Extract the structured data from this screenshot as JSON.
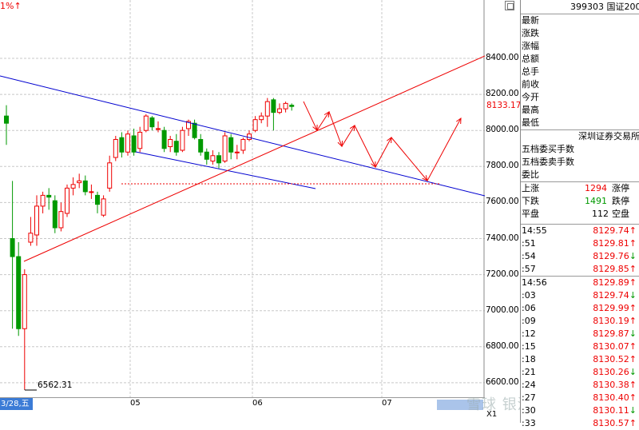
{
  "chart": {
    "corner_label": "1%↑",
    "low_label": "6562.31",
    "last_price": "8133.17",
    "axis_labels": [
      "8400.00",
      "8200.00",
      "8000.00",
      "7800.00",
      "7600.00",
      "7400.00",
      "7200.00",
      "7000.00",
      "6800.00",
      "6600.00"
    ],
    "date_box": "3/28,五",
    "date_ticks": [
      "05",
      "06",
      "07"
    ],
    "zoom_label": "X1"
  },
  "quote": {
    "code_name": "399303 国证2000",
    "fields": [
      "最新",
      "涨跌",
      "涨幅",
      "总额",
      "总手",
      "前收",
      "今开",
      "最高",
      "最低"
    ],
    "exchange": "深圳证券交易所",
    "fields2": [
      "五档委买手数",
      "五档委卖手数",
      "委比"
    ],
    "up_label": "上涨",
    "up_count": "1294",
    "limit_up_label": "涨停",
    "down_label": "下跌",
    "down_count": "1491",
    "limit_down_label": "跌停",
    "flat_label": "平盘",
    "flat_count": "112",
    "suspend_label": "空盘"
  },
  "ticks": [
    {
      "time": "14:55",
      "price": "8129.74",
      "dir": "↑"
    },
    {
      "time": ":51",
      "price": "8129.81",
      "dir": "↑"
    },
    {
      "time": ":54",
      "price": "8129.76",
      "dir": "↓"
    },
    {
      "time": ":57",
      "price": "8129.85",
      "dir": "↑"
    },
    {
      "time": "14:56",
      "price": "8129.89",
      "dir": "↑"
    },
    {
      "time": ":03",
      "price": "8129.74",
      "dir": "↓"
    },
    {
      "time": ":06",
      "price": "8129.99",
      "dir": "↑"
    },
    {
      "time": ":09",
      "price": "8130.19",
      "dir": "↑"
    },
    {
      "time": ":12",
      "price": "8129.87",
      "dir": "↓"
    },
    {
      "time": ":15",
      "price": "8130.07",
      "dir": "↑"
    },
    {
      "time": ":18",
      "price": "8130.52",
      "dir": "↑"
    },
    {
      "time": ":21",
      "price": "8130.26",
      "dir": "↓"
    },
    {
      "time": ":24",
      "price": "8130.38",
      "dir": "↑"
    },
    {
      "time": ":27",
      "price": "8130.40",
      "dir": "↑"
    },
    {
      "time": ":30",
      "price": "8130.11",
      "dir": "↓"
    },
    {
      "time": ":33",
      "price": "8130.57",
      "dir": "↑"
    }
  ],
  "watermark": "雪球 银河宝凡",
  "candles": [
    {
      "o": 8080,
      "c": 8040,
      "h": 8140,
      "l": 7920
    },
    {
      "o": 7400,
      "c": 7300,
      "h": 7720,
      "l": 6900
    },
    {
      "o": 7300,
      "c": 6900,
      "h": 7380,
      "l": 6860
    },
    {
      "o": 6900,
      "c": 7200,
      "h": 7230,
      "l": 6562
    },
    {
      "o": 7380,
      "c": 7430,
      "h": 7520,
      "l": 7360
    },
    {
      "o": 7420,
      "c": 7580,
      "h": 7640,
      "l": 7360
    },
    {
      "o": 7580,
      "c": 7640,
      "h": 7660,
      "l": 7540
    },
    {
      "o": 7640,
      "c": 7630,
      "h": 7680,
      "l": 7560
    },
    {
      "o": 7610,
      "c": 7460,
      "h": 7640,
      "l": 7430
    },
    {
      "o": 7460,
      "c": 7550,
      "h": 7600,
      "l": 7440
    },
    {
      "o": 7540,
      "c": 7680,
      "h": 7700,
      "l": 7520
    },
    {
      "o": 7680,
      "c": 7700,
      "h": 7740,
      "l": 7640
    },
    {
      "o": 7710,
      "c": 7720,
      "h": 7760,
      "l": 7680
    },
    {
      "o": 7720,
      "c": 7660,
      "h": 7750,
      "l": 7640
    },
    {
      "o": 7660,
      "c": 7660,
      "h": 7700,
      "l": 7620
    },
    {
      "o": 7640,
      "c": 7590,
      "h": 7660,
      "l": 7540
    },
    {
      "o": 7530,
      "c": 7620,
      "h": 7640,
      "l": 7520
    },
    {
      "o": 7680,
      "c": 7820,
      "h": 7860,
      "l": 7660
    },
    {
      "o": 7850,
      "c": 7950,
      "h": 7970,
      "l": 7830
    },
    {
      "o": 7960,
      "c": 7880,
      "h": 7990,
      "l": 7850
    },
    {
      "o": 7880,
      "c": 7980,
      "h": 8000,
      "l": 7860
    },
    {
      "o": 7970,
      "c": 7880,
      "h": 8010,
      "l": 7860
    },
    {
      "o": 7900,
      "c": 7990,
      "h": 8020,
      "l": 7880
    },
    {
      "o": 8000,
      "c": 8080,
      "h": 8090,
      "l": 7990
    },
    {
      "o": 8070,
      "c": 8020,
      "h": 8080,
      "l": 8000
    },
    {
      "o": 8010,
      "c": 8010,
      "h": 8050,
      "l": 7990
    },
    {
      "o": 8000,
      "c": 7900,
      "h": 8020,
      "l": 7880
    },
    {
      "o": 7910,
      "c": 7950,
      "h": 7970,
      "l": 7880
    },
    {
      "o": 7940,
      "c": 7880,
      "h": 7980,
      "l": 7860
    },
    {
      "o": 7890,
      "c": 8000,
      "h": 8020,
      "l": 7880
    },
    {
      "o": 8010,
      "c": 8050,
      "h": 8060,
      "l": 7970
    },
    {
      "o": 8040,
      "c": 7960,
      "h": 8060,
      "l": 7950
    },
    {
      "o": 7950,
      "c": 7880,
      "h": 7980,
      "l": 7860
    },
    {
      "o": 7880,
      "c": 7840,
      "h": 7900,
      "l": 7810
    },
    {
      "o": 7830,
      "c": 7860,
      "h": 7890,
      "l": 7810
    },
    {
      "o": 7860,
      "c": 7820,
      "h": 7880,
      "l": 7790
    },
    {
      "o": 7830,
      "c": 7970,
      "h": 7990,
      "l": 7820
    },
    {
      "o": 7960,
      "c": 7880,
      "h": 7980,
      "l": 7840
    },
    {
      "o": 7880,
      "c": 7880,
      "h": 7920,
      "l": 7840
    },
    {
      "o": 7890,
      "c": 7950,
      "h": 7960,
      "l": 7870
    },
    {
      "o": 7950,
      "c": 7980,
      "h": 8000,
      "l": 7940
    },
    {
      "o": 8000,
      "c": 8060,
      "h": 8080,
      "l": 7990
    },
    {
      "o": 8060,
      "c": 8080,
      "h": 8100,
      "l": 8040
    },
    {
      "o": 8080,
      "c": 8160,
      "h": 8180,
      "l": 8020
    },
    {
      "o": 8170,
      "c": 8100,
      "h": 8180,
      "l": 8000
    },
    {
      "o": 8100,
      "c": 8120,
      "h": 8150,
      "l": 8090
    },
    {
      "o": 8120,
      "c": 8150,
      "h": 8160,
      "l": 8100
    },
    {
      "o": 8140,
      "c": 8133,
      "h": 8150,
      "l": 8110
    }
  ]
}
